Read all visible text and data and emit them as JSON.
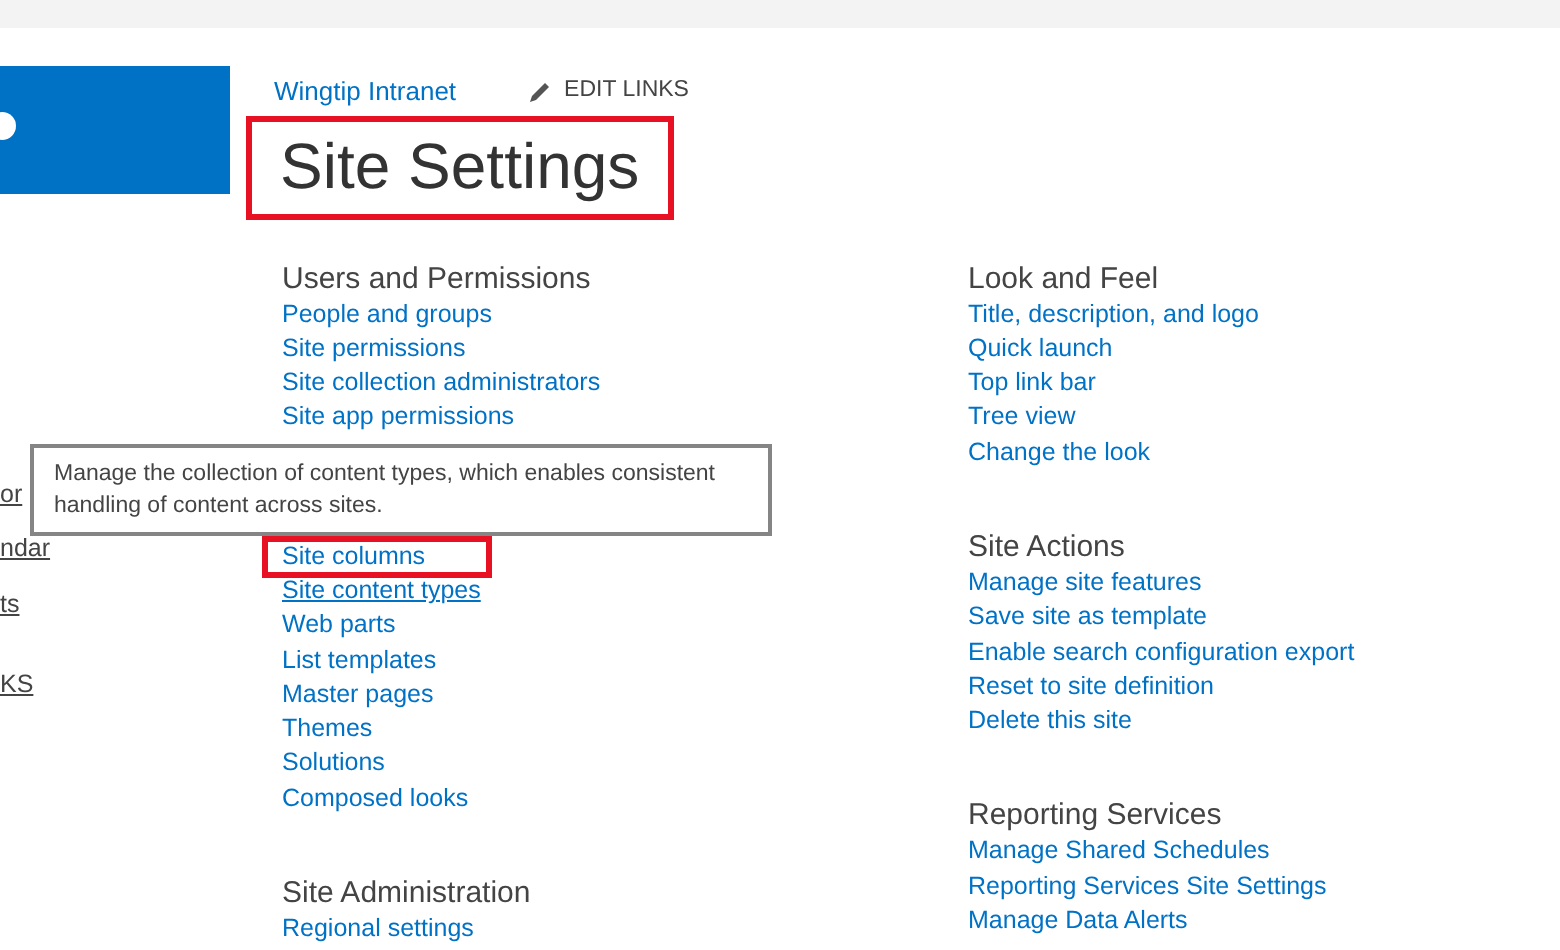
{
  "breadcrumb": {
    "site_link": "Wingtip Intranet",
    "edit_links": "EDIT LINKS"
  },
  "title": {
    "text": "Site Settings",
    "highlighted": true
  },
  "left_nav": [
    "or",
    "ndar",
    "ts",
    "KS"
  ],
  "columns": [
    [
      {
        "heading": "Users and Permissions",
        "links": [
          {
            "text": "People and groups",
            "highlighted": false,
            "hovered": false
          },
          {
            "text": "Site permissions",
            "highlighted": false,
            "hovered": false
          },
          {
            "text": "Site collection administrators",
            "highlighted": false,
            "hovered": false
          },
          {
            "text": "Site app permissions",
            "highlighted": false,
            "hovered": false
          }
        ]
      },
      {
        "links": [
          {
            "text": "Site columns",
            "highlighted": true,
            "hovered": false
          },
          {
            "text": "Site content types",
            "highlighted": false,
            "hovered": true
          },
          {
            "text": "Web parts",
            "highlighted": false,
            "hovered": false
          },
          {
            "text": "List templates",
            "highlighted": false,
            "hovered": false
          },
          {
            "text": "Master pages",
            "highlighted": false,
            "hovered": false
          },
          {
            "text": "Themes",
            "highlighted": false,
            "hovered": false
          },
          {
            "text": "Solutions",
            "highlighted": false,
            "hovered": false
          },
          {
            "text": "Composed looks",
            "highlighted": false,
            "hovered": false
          }
        ]
      },
      {
        "heading": "Site Administration",
        "links": [
          {
            "text": "Regional settings",
            "highlighted": false,
            "hovered": false
          }
        ]
      }
    ],
    [
      {
        "heading": "Look and Feel",
        "links": [
          {
            "text": "Title, description, and logo",
            "highlighted": false,
            "hovered": false
          },
          {
            "text": "Quick launch",
            "highlighted": false,
            "hovered": false
          },
          {
            "text": "Top link bar",
            "highlighted": false,
            "hovered": false
          },
          {
            "text": "Tree view",
            "highlighted": false,
            "hovered": false
          },
          {
            "text": "Change the look",
            "highlighted": false,
            "hovered": false
          }
        ]
      },
      {
        "heading": "Site Actions",
        "links": [
          {
            "text": "Manage site features",
            "highlighted": false,
            "hovered": false
          },
          {
            "text": "Save site as template",
            "highlighted": false,
            "hovered": false
          },
          {
            "text": "Enable search configuration export",
            "highlighted": false,
            "hovered": false
          },
          {
            "text": "Reset to site definition",
            "highlighted": false,
            "hovered": false
          },
          {
            "text": "Delete this site",
            "highlighted": false,
            "hovered": false
          }
        ]
      },
      {
        "heading": "Reporting Services",
        "links": [
          {
            "text": "Manage Shared Schedules",
            "highlighted": false,
            "hovered": false
          },
          {
            "text": "Reporting Services Site Settings",
            "highlighted": false,
            "hovered": false
          },
          {
            "text": "Manage Data Alerts",
            "highlighted": false,
            "hovered": false
          }
        ]
      }
    ]
  ],
  "tooltip": "Manage the collection of content types, which enables consistent handling of content across sites."
}
